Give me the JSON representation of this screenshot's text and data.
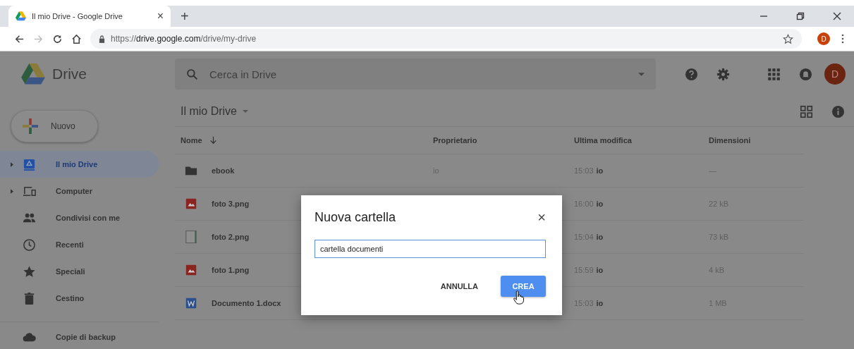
{
  "browser": {
    "tab": {
      "title": "Il mio Drive - Google Drive",
      "close": "×"
    },
    "new_tab": "+",
    "url": "https://**drive.google.com**/drive/my-drive",
    "profile_initial": "D"
  },
  "header": {
    "app_name": "Drive",
    "search": {
      "placeholder": "Cerca in Drive"
    },
    "avatar_initial": "D"
  },
  "new_button": "Nuovo",
  "sidebar": {
    "items": [
      {
        "kind": "drive",
        "label": "Il mio Drive",
        "selected": true,
        "expandable": true
      },
      {
        "kind": "computer",
        "label": "Computer",
        "selected": false,
        "expandable": true
      },
      {
        "kind": "shared",
        "label": "Condivisi con me",
        "selected": false,
        "expandable": false
      },
      {
        "kind": "recent",
        "label": "Recenti",
        "selected": false,
        "expandable": false
      },
      {
        "kind": "starred",
        "label": "Speciali",
        "selected": false,
        "expandable": false
      },
      {
        "kind": "trash",
        "label": "Cestino",
        "selected": false,
        "expandable": false
      }
    ],
    "backup": {
      "label": "Copie di backup"
    }
  },
  "breadcrumb": "Il mio Drive",
  "table": {
    "columns": [
      "Nome",
      "Proprietario",
      "Ultima modifica",
      "Dimensioni"
    ],
    "rows": [
      {
        "kind": "folder",
        "name": "ebook",
        "owner": "io",
        "time": "15:03",
        "by": "io",
        "size": "—"
      },
      {
        "kind": "image",
        "name": "foto 3.png",
        "time": "16:00",
        "by": "io",
        "size": "22 kB"
      },
      {
        "kind": "blank",
        "name": "foto 2.png",
        "time": "15:04",
        "by": "io",
        "size": "73 kB"
      },
      {
        "kind": "image",
        "name": "foto 1.png",
        "time": "15:59",
        "by": "io",
        "size": "4 kB"
      },
      {
        "kind": "word",
        "name": "Documento 1.docx",
        "time": "15:03",
        "by": "io",
        "size": "1 MB"
      }
    ]
  },
  "dialog": {
    "title": "Nuova cartella",
    "close": "×",
    "input": {
      "value": "cartella documenti"
    },
    "buttons": [
      {
        "kind": "text",
        "label": "ANNULLA"
      },
      {
        "kind": "primary",
        "label": "CREA"
      }
    ]
  }
}
